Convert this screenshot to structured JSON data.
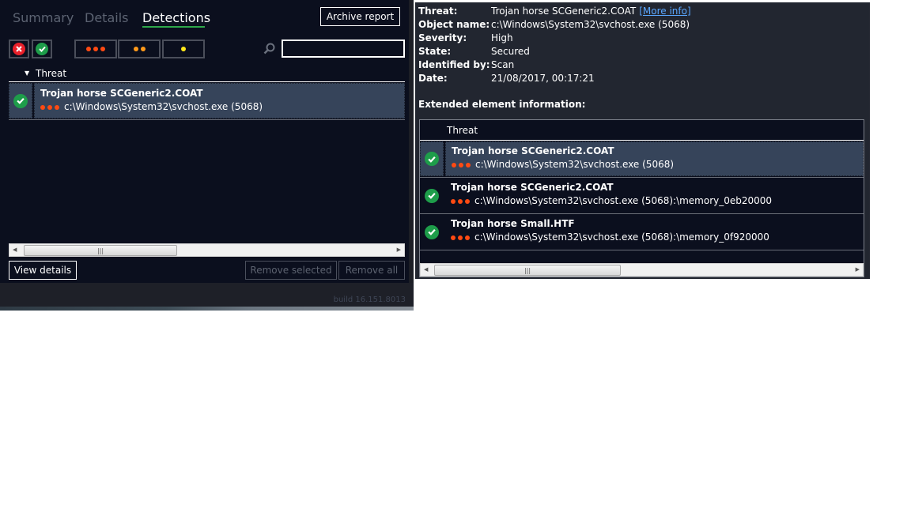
{
  "left_panel": {
    "tabs": [
      {
        "label": "Summary",
        "active": false
      },
      {
        "label": "Details",
        "active": false
      },
      {
        "label": "Detections",
        "active": true
      }
    ],
    "archive_button": "Archive report",
    "filters": {
      "status_icons": [
        "error-icon",
        "check-icon"
      ],
      "severity_filters": [
        {
          "level": "high",
          "dots": 3,
          "color": "#ff4a12"
        },
        {
          "level": "medium",
          "dots": 2,
          "color": "#ff9a1a"
        },
        {
          "level": "low",
          "dots": 1,
          "color": "#ffe81a"
        }
      ]
    },
    "search": {
      "value": "",
      "placeholder": ""
    },
    "column_header": "Threat",
    "rows": [
      {
        "name": "Trojan horse SCGeneric2.COAT",
        "path": "c:\\Windows\\System32\\svchost.exe (5068)",
        "status": "check-icon",
        "severity_dots": 3,
        "selected": true
      }
    ],
    "buttons": {
      "view_details": "View details",
      "remove_selected": "Remove selected",
      "remove_all": "Remove all"
    },
    "build": "build 16.151.8013"
  },
  "right_panel": {
    "details": [
      {
        "key": "Threat:",
        "value": "Trojan horse SCGeneric2.COAT",
        "link": "[More info]"
      },
      {
        "key": "Object name:",
        "value": "c:\\Windows\\System32\\svchost.exe (5068)"
      },
      {
        "key": "Severity:",
        "value": "High"
      },
      {
        "key": "State:",
        "value": "Secured"
      },
      {
        "key": "Identified by:",
        "value": "Scan"
      },
      {
        "key": "Date:",
        "value": "21/08/2017, 00:17:21"
      }
    ],
    "extended_title": "Extended element information:",
    "column_header": "Threat",
    "rows": [
      {
        "name": "Trojan horse SCGeneric2.COAT",
        "path": "c:\\Windows\\System32\\svchost.exe (5068)",
        "selected": true
      },
      {
        "name": "Trojan horse SCGeneric2.COAT",
        "path": "c:\\Windows\\System32\\svchost.exe (5068):\\memory_0eb20000",
        "selected": false
      },
      {
        "name": "Trojan horse Small.HTF",
        "path": "c:\\Windows\\System32\\svchost.exe (5068):\\memory_0f920000",
        "selected": false
      }
    ]
  },
  "colors": {
    "accent_green": "#2ea84a",
    "severity_high": "#ff4a12",
    "error_red": "#e8202a",
    "link_blue": "#5aa7ff"
  }
}
